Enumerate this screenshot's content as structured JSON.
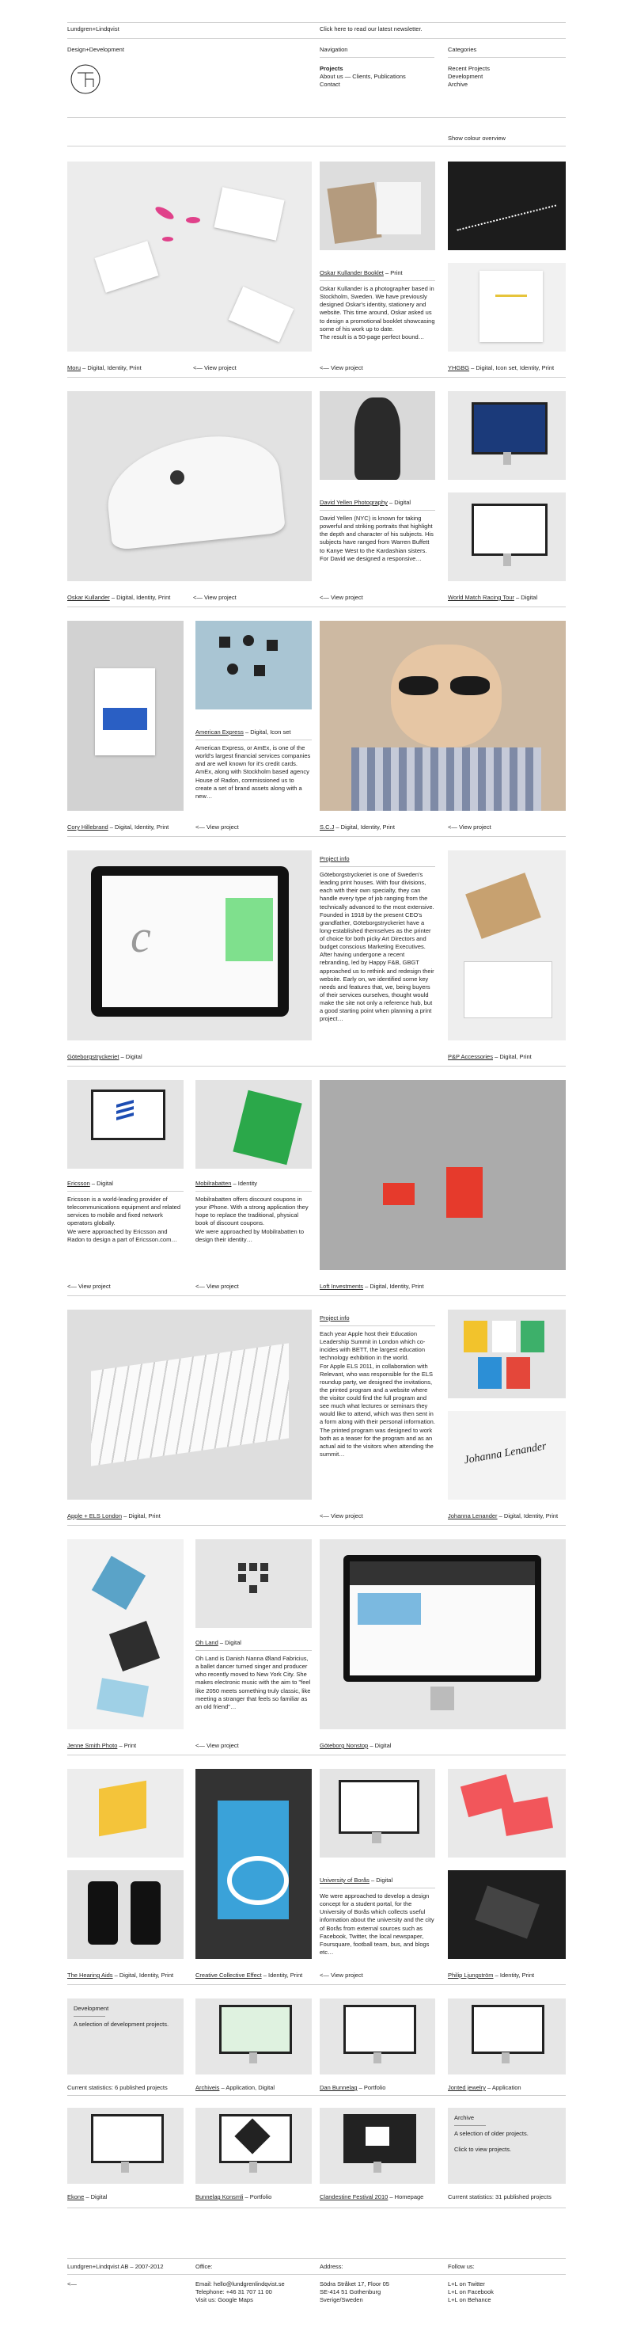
{
  "header": {
    "brand": "Lundgren+Lindqvist",
    "tagline": "Design+Development",
    "newsletter": "Click here to read our latest newsletter.",
    "nav_heading": "Navigation",
    "nav_current": "Projects",
    "nav_about": "About us — Clients, Publications",
    "nav_contact": "Contact",
    "cat_heading": "Categories",
    "cat_recent": "Recent Projects",
    "cat_dev": "Development",
    "cat_archive": "Archive",
    "colour_overview": "Show colour overview"
  },
  "view_project": "<— View project",
  "projects": {
    "moru": {
      "title": "Moru",
      "tags": " – Digital, Identity, Print"
    },
    "oskar_booklet": {
      "title": "Oskar Kullander Booklet",
      "tags": " – Print",
      "body": "Oskar Kullander is a photographer based in Stockholm, Sweden. We have previously designed Oskar's identity, stationery and website. This time around, Oskar asked us to design a promotional booklet showcasing some of his work up to date.\nThe result is a 50-page perfect bound…"
    },
    "yhgbg": {
      "title": "YHGBG",
      "tags": " – Digital, Icon set, Identity, Print"
    },
    "oskar": {
      "title": "Oskar Kullander",
      "tags": " – Digital, Identity, Print"
    },
    "david": {
      "title": "David Yellen Photography",
      "tags": " – Digital",
      "body": "David Yellen (NYC) is known for taking powerful and striking portraits that highlight the depth and character of his subjects. His subjects have ranged from Warren Buffett to Kanye West to the Kardashian sisters.\nFor David we designed a responsive…"
    },
    "wmrt": {
      "title": "World Match Racing Tour",
      "tags": " – Digital"
    },
    "amex": {
      "title": "American Express",
      "tags": " – Digital, Icon set",
      "body": "American Express, or AmEx, is one of the world's largest financial services companies and are well known for it's credit cards.\nAmEx, along with Stockholm based agency House of Radon, commissioned us to create a set of brand assets along with a new…"
    },
    "cory": {
      "title": "Cory Hillebrand",
      "tags": " – Digital, Identity, Print"
    },
    "scj": {
      "title": "S.C.J",
      "tags": " – Digital, Identity, Print"
    },
    "gbt": {
      "title": "Göteborgstryckeriet",
      "tags": " – Digital"
    },
    "pp": {
      "title": "P&P Accessories",
      "tags": " – Digital, Print"
    },
    "gbt_info": {
      "title": "Project info",
      "body": "Göteborgstryckeriet is one of Sweden's leading print houses. With four divisions, each with their own specialty, they can handle every type of job ranging from the technically advanced to the most extensive.\nFounded in 1918 by the present CEO's grandfather, Göteborgstryckeriet have a long-established themselves as the printer of choice for both picky Art Directors and budget conscious Marketing Executives.\nAfter having undergone a recent rebranding, led by Happy F&B, GBGT approached us to rethink and redesign their website. Early on, we identified some key needs and features that, we, being buyers of their services ourselves, thought would make the site not only a reference hub, but a good starting point when planning a print project…"
    },
    "ericsson": {
      "title": "Ericsson",
      "tags": " – Digital",
      "body": "Ericsson is a world-leading provider of telecommunications equipment and related services to mobile and fixed network operators globally.\nWe were approached by Ericsson and Radon to design a part of Ericsson.com…"
    },
    "mobil": {
      "title": "Mobilrabatten",
      "tags": " – Identity",
      "body": "Mobilrabatten offers discount coupons in your iPhone. With a strong application they hope to replace the traditional, physical book of discount coupons.\nWe were approached by Mobilrabatten to design their identity…"
    },
    "loft": {
      "title": "Loft Investments",
      "tags": " – Digital, Identity, Print"
    },
    "apple": {
      "title": "Apple + ELS London",
      "tags": " – Digital, Print"
    },
    "apple_info": {
      "title": "Project info",
      "body": "Each year Apple host their Education Leadership Summit in London which co-incides with BETT, the largest education technology exhibition in the world.\nFor Apple ELS 2011, in collaboration with Relevant, who was responsible for the ELS roundup party, we designed the invitations, the printed program and a website where the visitor could find the full program and see much what lectures or seminars they would like to attend, which was then sent in a form along with their personal information.\nThe printed program was designed to work both as a teaser for the program and as an actual aid to the visitors when attending the summit…"
    },
    "johanna": {
      "title": "Johanna Lenander",
      "tags": " – Digital, Identity, Print"
    },
    "ohland": {
      "title": "Oh Land",
      "tags": " – Digital",
      "body": "Oh Land is Danish Nanna Øland Fabricius, a ballet dancer turned singer and producer who recently moved to New York City. She makes electronic music with the aim to \"feel like 2050 meets something truly classic, like meeting a stranger that feels so familiar as an old friend\"…"
    },
    "jenne": {
      "title": "Jenne Smith Photo",
      "tags": " – Print"
    },
    "goteborg": {
      "title": "Göteborg Nonstop",
      "tags": " – Digital"
    },
    "uob": {
      "title": "University of Borås",
      "tags": " – Digital",
      "body": "We were approached to develop a design concept for a student portal, for the University of Borås which collects useful information about the university and the city of Borås from external sources such as Facebook, Twitter, the local newspaper, Foursquare, football team, bus, and blogs etc…"
    },
    "hearing": {
      "title": "The Hearing Aids",
      "tags": " – Digital, Identity, Print"
    },
    "cce": {
      "title": "Creative Collective Effect",
      "tags": " – Identity, Print"
    },
    "philip": {
      "title": "Philip Ljungström",
      "tags": " – Identity, Print"
    },
    "arch": {
      "title": "Archiveis",
      "tags": " – Application, Digital"
    },
    "dan": {
      "title": "Dan Bunnelag",
      "tags": " – Portfolio"
    },
    "jonted": {
      "title": "Jonted jewelry",
      "tags": " – Application"
    },
    "ekone": {
      "title": "Ekone",
      "tags": " – Digital"
    },
    "bunnelag": {
      "title": "Bunnelag Konsmli",
      "tags": " – Portfolio"
    },
    "clandestine": {
      "title": "Clandestine Festival 2010",
      "tags": " – Homepage"
    }
  },
  "dev_box": {
    "title": "Development",
    "body": "A selection of development projects."
  },
  "dev_stats": "Current statistics: 6 published projects",
  "archive_box": {
    "title": "Archive",
    "body": "A selection of older projects.\n\nClick to view projects."
  },
  "archive_stats": "Current statistics: 31 published projects",
  "footer": {
    "copyright": "Lundgren+Lindqvist AB – 2007-2012",
    "back": "<—",
    "office_h": "Office:",
    "office": "Email: hello@lundgrenlindqvist.se\nTelephone: +46 31 707 11 00\nVisit us: Google Maps",
    "address_h": "Address:",
    "address": "Södra Stråket 17, Floor 05\nSE-414 51 Gothenburg\nSverige/Sweden",
    "follow_h": "Follow us:",
    "follow": "L+L on Twitter\nL+L on Facebook\nL+L on Behance"
  },
  "colors": {
    "rule": "#cfcfcf",
    "text": "#222222",
    "photo_grey": "#d6d6d6",
    "accent_pink": "#e0418a",
    "accent_red": "#e63a2c"
  }
}
